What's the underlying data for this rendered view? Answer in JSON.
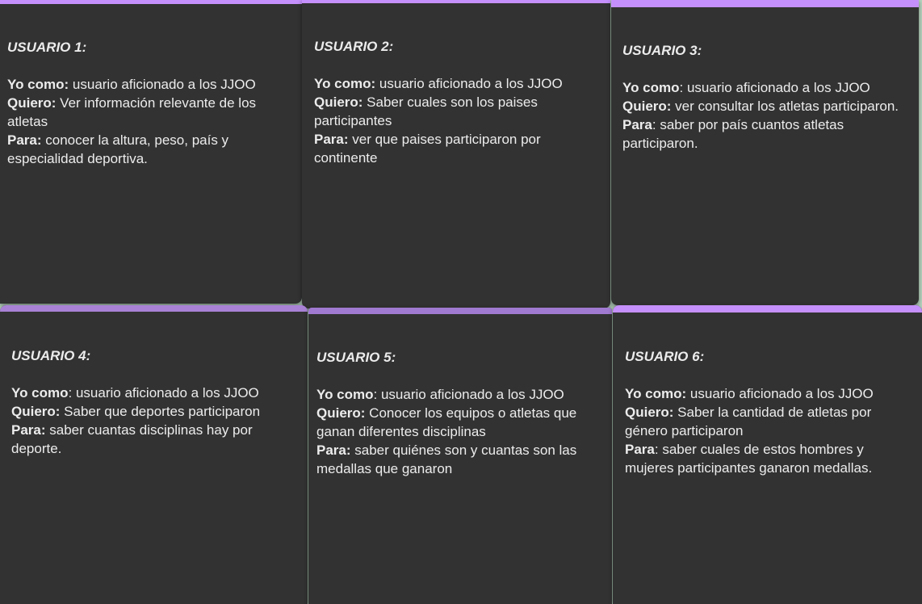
{
  "colors": {
    "card_background": "#323232",
    "accent_bar": "#c590fb",
    "text": "#ececec"
  },
  "cards": [
    {
      "title": "USUARIO 1:",
      "yo_como_label": "Yo como:",
      "yo_como_text": " usuario aficionado a los JJOO",
      "quiero_label": "Quiero:",
      "quiero_text": " Ver información relevante de los atletas",
      "para_label": "Para:",
      "para_text": " conocer la altura, peso, país y especialidad deportiva."
    },
    {
      "title": "USUARIO 2:",
      "yo_como_label": "Yo como:",
      "yo_como_text": " usuario aficionado a los JJOO",
      "quiero_label": "Quiero:",
      "quiero_text": " Saber cuales son los paises participantes",
      "para_label": "Para:",
      "para_text": " ver que paises participaron por continente"
    },
    {
      "title": "USUARIO 3:",
      "yo_como_label": "Yo como",
      "yo_como_text": ": usuario aficionado a los JJOO",
      "quiero_label": "Quiero:",
      "quiero_text": " ver consultar los atletas participaron.",
      "para_label": "Para",
      "para_text": ": saber por país cuantos atletas participaron."
    },
    {
      "title": "USUARIO 4:",
      "yo_como_label": "Yo como",
      "yo_como_text": ": usuario aficionado a los JJOO",
      "quiero_label": "Quiero:",
      "quiero_text": " Saber que deportes participaron",
      "para_label": "Para:",
      "para_text": " saber cuantas disciplinas hay por deporte."
    },
    {
      "title": "USUARIO 5:",
      "yo_como_label": "Yo como",
      "yo_como_text": ": usuario aficionado a los JJOO",
      "quiero_label": "Quiero:",
      "quiero_text": " Conocer los equipos o atletas que ganan diferentes disciplinas",
      "para_label": "Para:",
      "para_text": " saber quiénes son y cuantas son las medallas que ganaron"
    },
    {
      "title": "USUARIO 6:",
      "yo_como_label": "Yo como:",
      "yo_como_text": " usuario aficionado a los JJOO",
      "quiero_label": "Quiero:",
      "quiero_text": " Saber la cantidad de atletas por género participaron",
      "para_label": "Para",
      "para_text": ": saber cuales de estos hombres y mujeres participantes ganaron medallas."
    }
  ]
}
